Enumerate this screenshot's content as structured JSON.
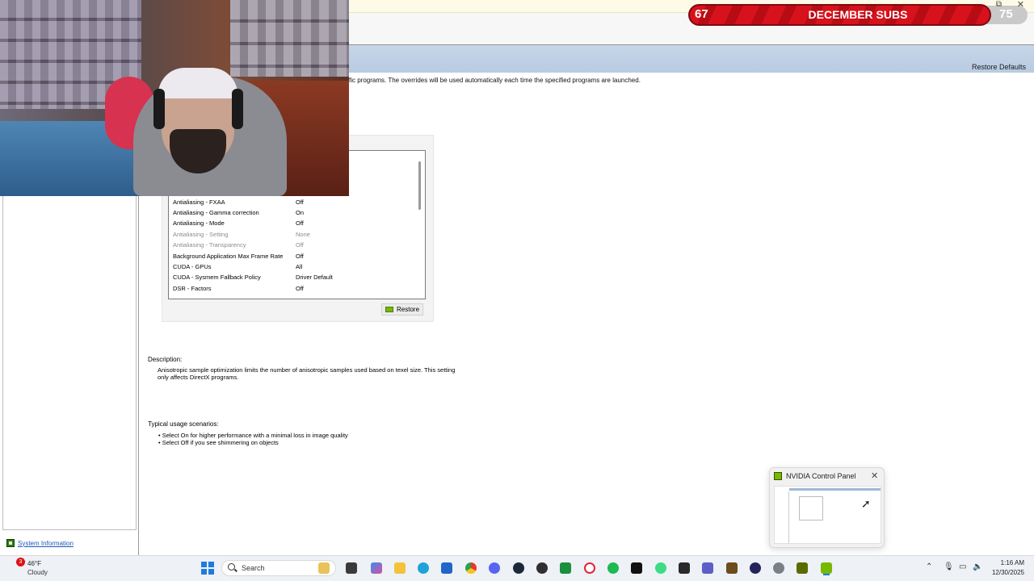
{
  "header": {
    "restore_defaults": "Restore Defaults",
    "intro_text": "fic programs. The overrides will be used automatically each time the specified programs are launched."
  },
  "settings": {
    "rows": [
      {
        "name": "Antialiasing - FXAA",
        "value": "Off",
        "disabled": false
      },
      {
        "name": "Antialiasing - Gamma correction",
        "value": "On",
        "disabled": false
      },
      {
        "name": "Antialiasing - Mode",
        "value": "Off",
        "disabled": false
      },
      {
        "name": "Antialiasing - Setting",
        "value": "None",
        "disabled": true
      },
      {
        "name": "Antialiasing - Transparency",
        "value": "Off",
        "disabled": true
      },
      {
        "name": "Background Application Max Frame Rate",
        "value": "Off",
        "disabled": false
      },
      {
        "name": "CUDA - GPUs",
        "value": "All",
        "disabled": false
      },
      {
        "name": "CUDA - Sysmem Fallback Policy",
        "value": "Driver Default",
        "disabled": false
      },
      {
        "name": "DSR - Factors",
        "value": "Off",
        "disabled": false
      }
    ],
    "restore_label": "Restore"
  },
  "description": {
    "label": "Description:",
    "text": "Anisotropic sample optimization limits the number of anisotropic samples used based on texel size. This setting only affects DirectX programs."
  },
  "usage": {
    "label": "Typical usage scenarios:",
    "items": [
      "• Select On for higher performance with a minimal loss in image quality",
      "• Select Off if you see shimmering on objects"
    ]
  },
  "sidebar": {
    "system_information": "System Information"
  },
  "subs_banner": {
    "current": "67",
    "title": "DECEMBER SUBS",
    "goal": "75",
    "progress": 0.893
  },
  "preview": {
    "title": "NVIDIA Control Panel"
  },
  "taskbar": {
    "weather_temp": "46°F",
    "weather_desc": "Cloudy",
    "weather_badge": "3",
    "search_placeholder": "Search",
    "time": "1:16 AM",
    "date": "12/30/2025",
    "icons": [
      "file-explorer-icon",
      "copilot-icon",
      "folder-icon",
      "edge-icon",
      "store-icon",
      "chrome-icon",
      "discord-icon",
      "steam-icon",
      "obs-icon",
      "xbox-icon",
      "opera-icon",
      "spotify-icon",
      "capcut-icon",
      "android-icon",
      "epic-games-icon",
      "teams-icon",
      "app-icon",
      "media-icon",
      "settings-icon",
      "nvidia-icon",
      "nvidia-control-panel-icon"
    ]
  },
  "colors": {
    "accent_green": "#76b900",
    "banner_red": "#d8121c",
    "header_blue": "#b8cbe2"
  }
}
